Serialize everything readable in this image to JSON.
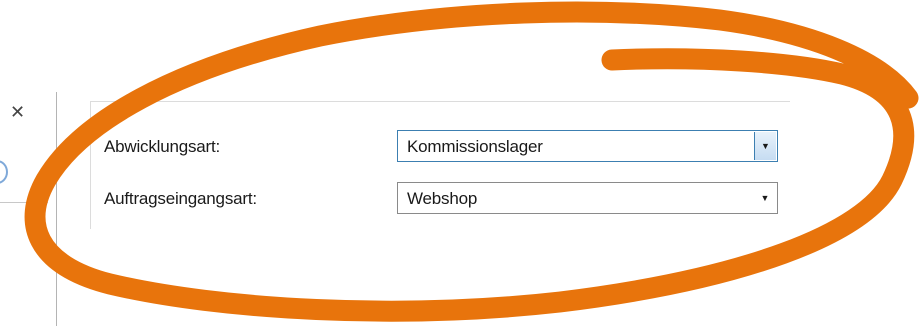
{
  "window": {
    "close_symbol": "✕"
  },
  "form": {
    "fields": [
      {
        "label": "Abwicklungsart:",
        "value": "Kommissionslager",
        "dropdown_icon": "▼"
      },
      {
        "label": "Auftragseingangsart:",
        "value": "Webshop",
        "dropdown_icon": "▼"
      }
    ]
  },
  "colors": {
    "annotation": "#e8740c",
    "active_border": "#3c7fb1"
  },
  "icons": {
    "close": "close-icon",
    "dropdown": "chevron-down-icon"
  }
}
